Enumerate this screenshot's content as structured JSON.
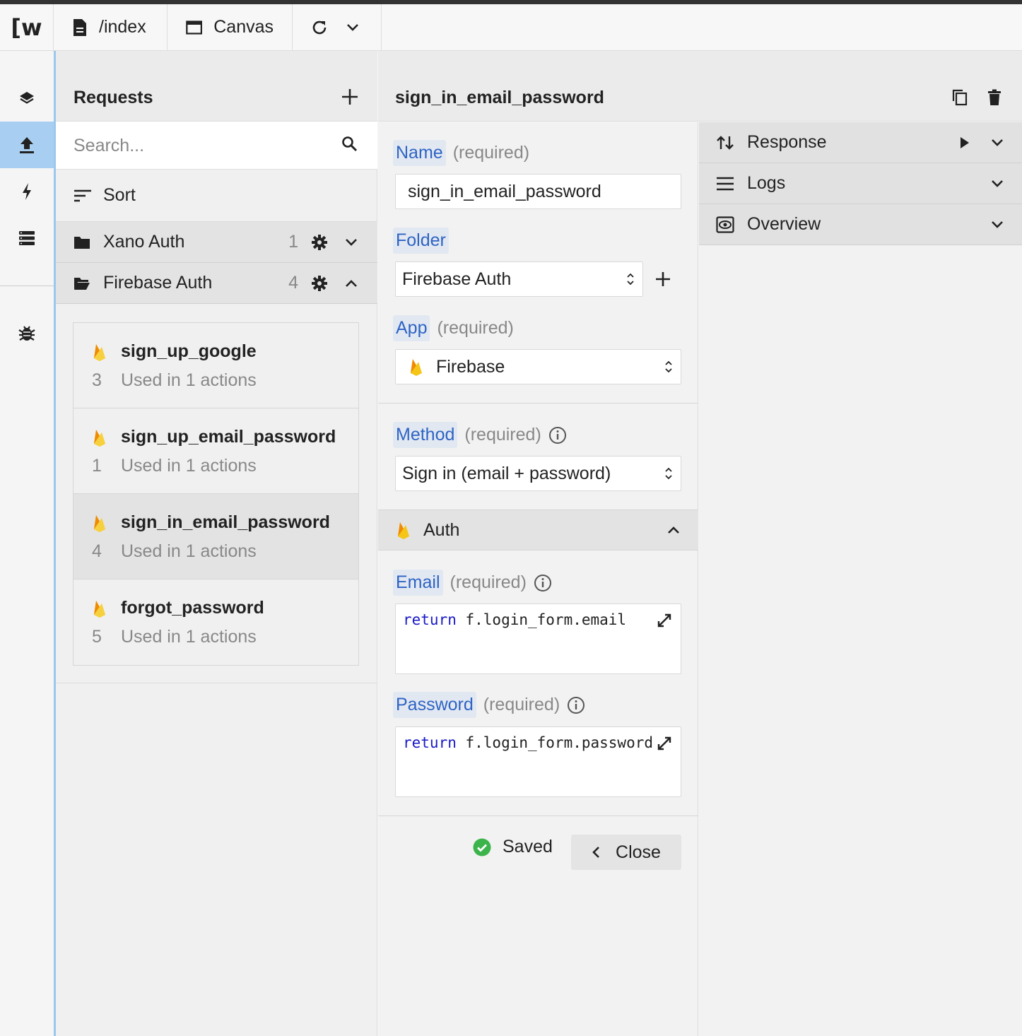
{
  "topbar": {
    "logo": "[w",
    "page_path": "/index",
    "canvas_label": "Canvas"
  },
  "rail": {
    "items": [
      {
        "icon": "layers-icon"
      },
      {
        "icon": "upload-icon",
        "active": true
      },
      {
        "icon": "bolt-icon"
      },
      {
        "icon": "database-icon"
      },
      {
        "icon": "bug-icon"
      }
    ]
  },
  "requests": {
    "title": "Requests",
    "search_placeholder": "Search...",
    "sort_label": "Sort",
    "folders": [
      {
        "name": "Xano Auth",
        "count": "1",
        "expanded": false
      },
      {
        "name": "Firebase Auth",
        "count": "4",
        "expanded": true
      }
    ],
    "items": [
      {
        "name": "sign_up_google",
        "number": "3",
        "usage": "Used in 1 actions"
      },
      {
        "name": "sign_up_email_password",
        "number": "1",
        "usage": "Used in 1 actions"
      },
      {
        "name": "sign_in_email_password",
        "number": "4",
        "usage": "Used in 1 actions",
        "selected": true
      },
      {
        "name": "forgot_password",
        "number": "5",
        "usage": "Used in 1 actions"
      }
    ]
  },
  "detail": {
    "title": "sign_in_email_password",
    "name_label": "Name",
    "required_text": "(required)",
    "name_value": "sign_in_email_password",
    "folder_label": "Folder",
    "folder_value": "Firebase Auth",
    "app_label": "App",
    "app_value": "Firebase",
    "method_label": "Method",
    "method_value": "Sign in (email + password)",
    "auth_section": "Auth",
    "email_label": "Email",
    "email_code_kw": "return",
    "email_code_expr": " f.login_form.email",
    "password_label": "Password",
    "password_code_kw": "return",
    "password_code_expr": " f.login_form.password",
    "saved_label": "Saved",
    "close_label": "Close"
  },
  "side": {
    "response_label": "Response",
    "logs_label": "Logs",
    "overview_label": "Overview"
  },
  "colors": {
    "accent_blue": "#2e64c5",
    "rail_active": "#a8cff2",
    "saved_green": "#3cb44b",
    "firebase_yellow": "#f5c518",
    "firebase_orange": "#f08a00"
  }
}
